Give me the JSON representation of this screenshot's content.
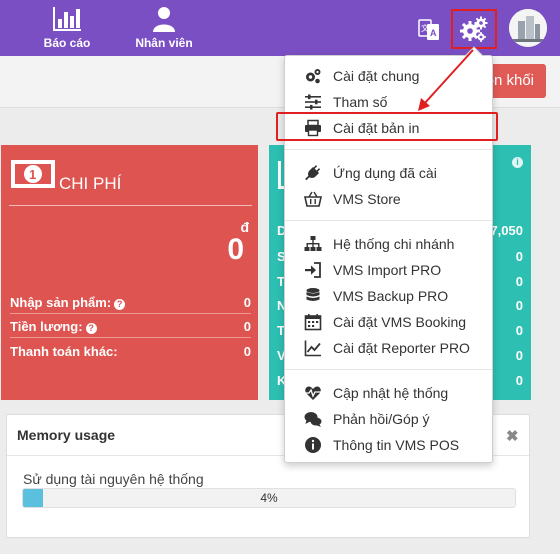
{
  "nav": {
    "reports_label": "Báo cáo",
    "staff_label": "Nhân viên",
    "language_icon": "translate-icon",
    "settings_icon": "gears-icon",
    "avatar_icon": "user-avatar"
  },
  "toolbar": {
    "action_label": "on khối"
  },
  "expense_card": {
    "title": "CHI PHÍ",
    "currency": "đ",
    "total": "0",
    "rows": [
      {
        "label": "Nhập sản phẩm:",
        "value": "0",
        "help": true
      },
      {
        "label": "Tiền lương:",
        "value": "0",
        "help": true
      },
      {
        "label": "Thanh toán khác:",
        "value": "0",
        "help": false
      }
    ],
    "color": "#de5450"
  },
  "revenue_card": {
    "color": "#2dbfb2",
    "row_initials": [
      "D",
      "S",
      "T",
      "N",
      "T",
      "V",
      "K"
    ],
    "values": [
      "7,050",
      "0",
      "0",
      "0",
      "0",
      "0",
      "0"
    ]
  },
  "memory": {
    "title": "Memory usage",
    "label": "Sử dụng tài nguyên hệ thống",
    "percent_text": "4%",
    "percent": 4,
    "collapse": "–",
    "close": "✖"
  },
  "menu": {
    "items": [
      {
        "label": "Cài đặt chung",
        "icon": "gears-icon"
      },
      {
        "label": "Tham số",
        "icon": "sliders-icon"
      },
      {
        "label": "Cài đặt bản in",
        "icon": "printer-icon"
      },
      {
        "label": "Ứng dụng đã cài",
        "icon": "plug-icon"
      },
      {
        "label": "VMS Store",
        "icon": "basket-icon"
      },
      {
        "label": "Hệ thống chi nhánh",
        "icon": "sitemap-icon"
      },
      {
        "label": "VMS Import PRO",
        "icon": "sign-in-icon"
      },
      {
        "label": "VMS Backup PRO",
        "icon": "database-icon"
      },
      {
        "label": "Cài đặt VMS Booking",
        "icon": "calendar-icon"
      },
      {
        "label": "Cài đặt Reporter PRO",
        "icon": "line-chart-icon"
      },
      {
        "label": "Cập nhật hệ thống",
        "icon": "heartbeat-icon"
      },
      {
        "label": "Phản hồi/Góp ý",
        "icon": "comments-icon"
      },
      {
        "label": "Thông tin VMS POS",
        "icon": "info-circle-icon"
      }
    ]
  },
  "colors": {
    "topbar": "#7a4fc3",
    "annotation_red": "#e02020",
    "action_button": "#e05a56"
  }
}
